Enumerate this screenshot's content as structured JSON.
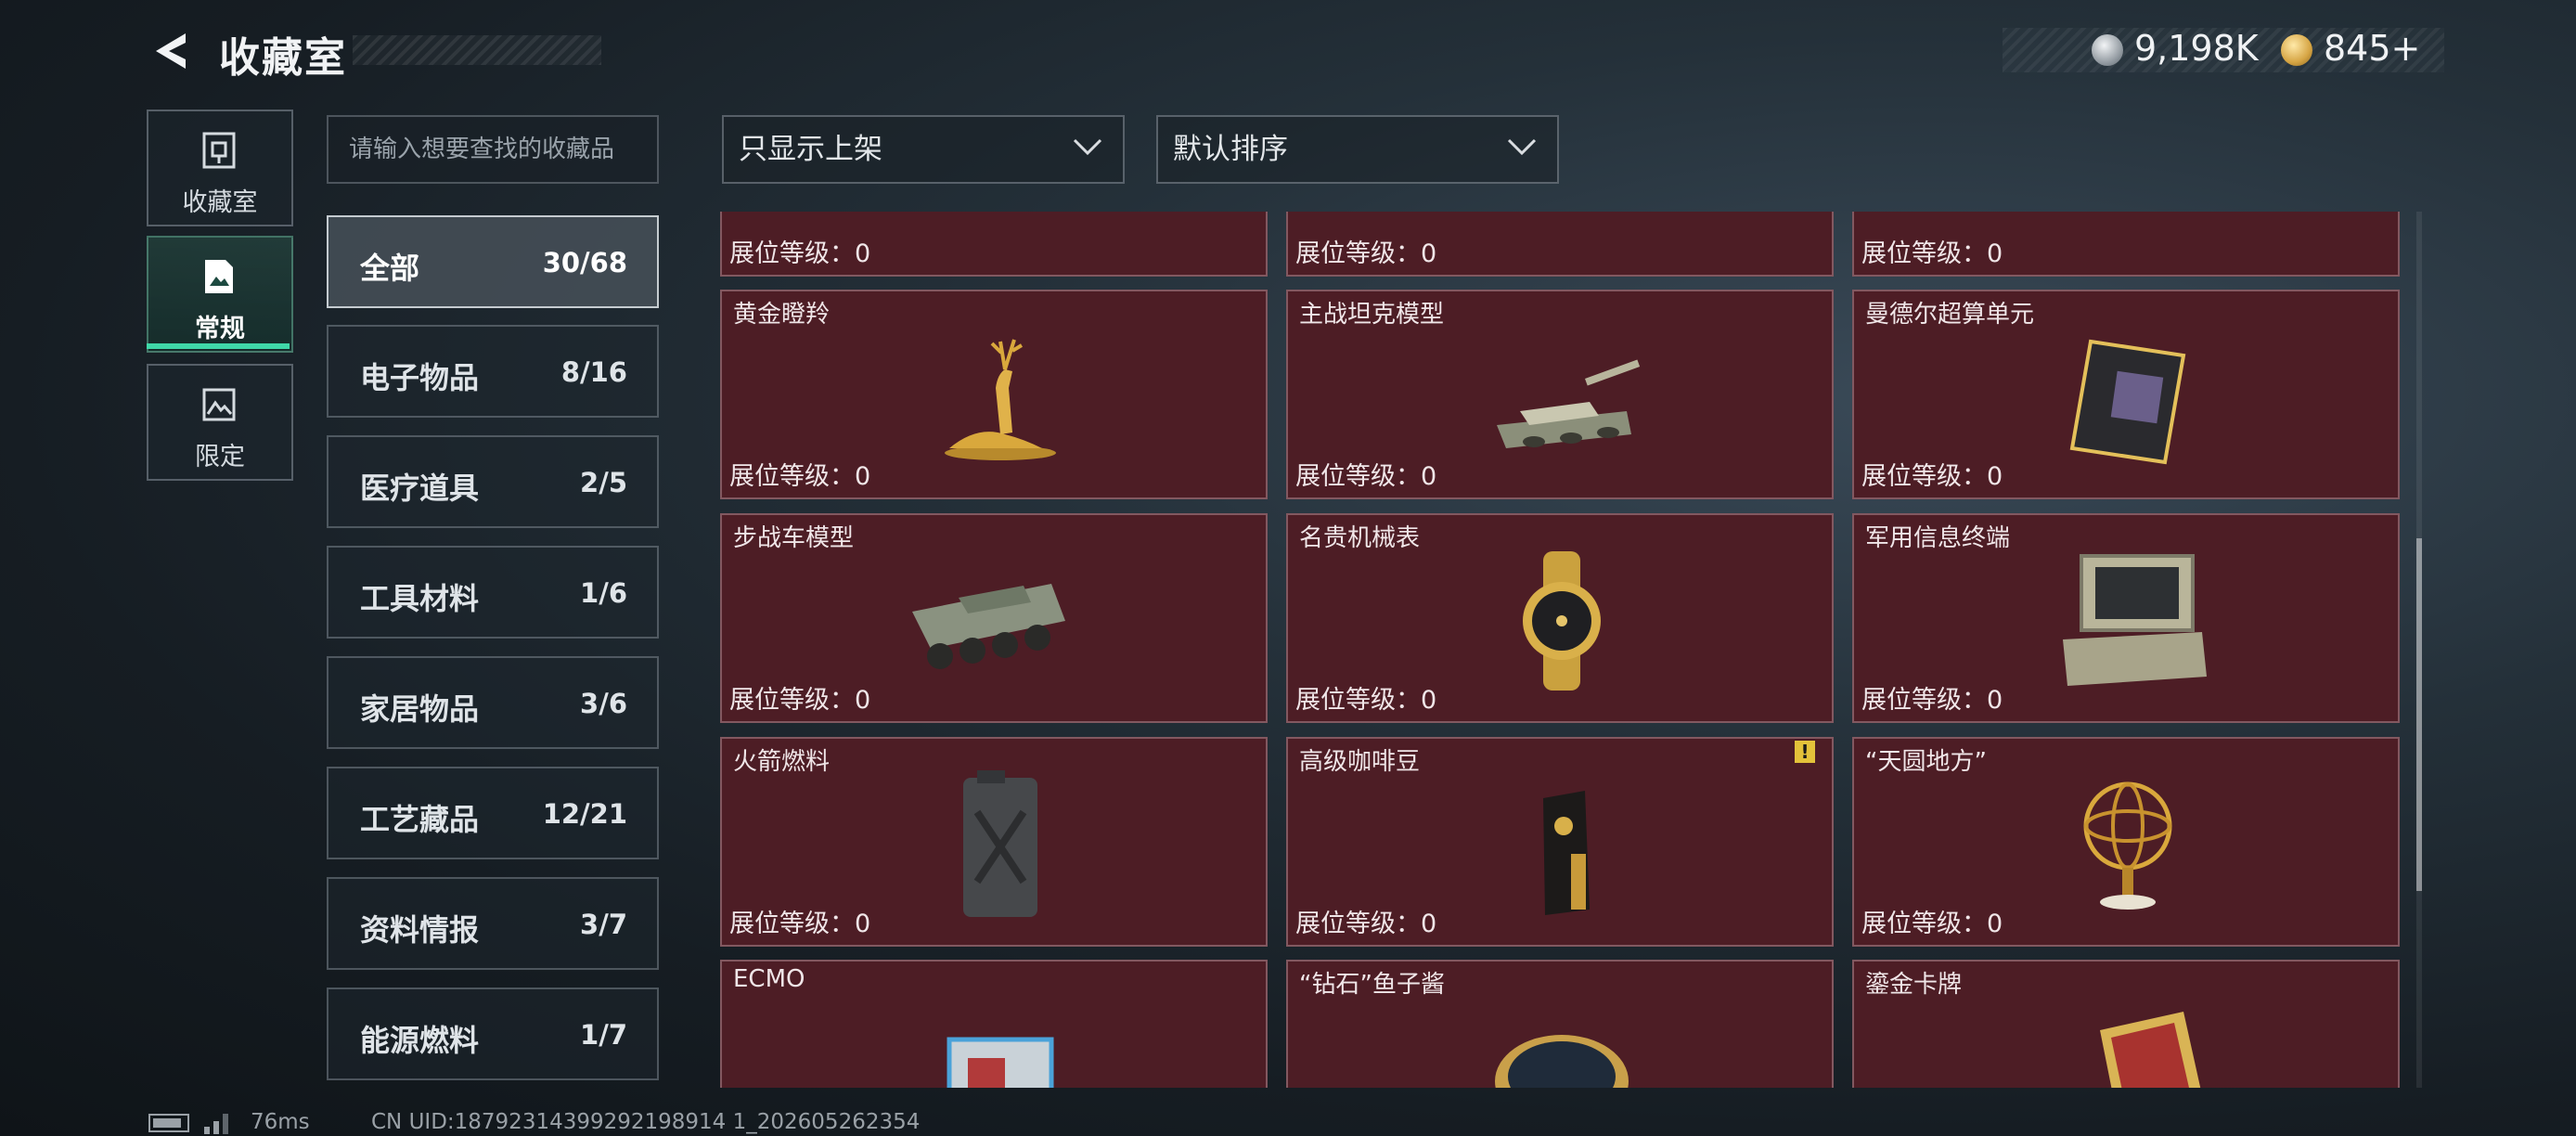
{
  "header": {
    "title": "收藏室",
    "currency_silver": "9,198K",
    "currency_gold": "845",
    "currency_gold_suffix": "+"
  },
  "side_tabs": [
    {
      "label": "收藏室",
      "icon": "vault-icon"
    },
    {
      "label": "常规",
      "icon": "document-icon",
      "active": true
    },
    {
      "label": "限定",
      "icon": "picture-icon"
    }
  ],
  "search": {
    "placeholder": "请输入想要查找的收藏品"
  },
  "filters": {
    "display": "只显示上架",
    "sort": "默认排序"
  },
  "categories": [
    {
      "name": "全部",
      "count": "30/68",
      "active": true
    },
    {
      "name": "电子物品",
      "count": "8/16"
    },
    {
      "name": "医疗道具",
      "count": "2/5"
    },
    {
      "name": "工具材料",
      "count": "1/6"
    },
    {
      "name": "家居物品",
      "count": "3/6"
    },
    {
      "name": "工艺藏品",
      "count": "12/21"
    },
    {
      "name": "资料情报",
      "count": "3/7"
    },
    {
      "name": "能源燃料",
      "count": "1/7"
    }
  ],
  "level_label": "展位等级：0",
  "items": [
    {
      "name": "",
      "icon": "partial-item-icon"
    },
    {
      "name": "",
      "icon": "partial-item-icon"
    },
    {
      "name": "",
      "icon": "partial-item-icon"
    },
    {
      "name": "黄金瞪羚",
      "icon": "golden-gazelle-icon"
    },
    {
      "name": "主战坦克模型",
      "icon": "tank-model-icon"
    },
    {
      "name": "曼德尔超算单元",
      "icon": "supercomputer-unit-icon"
    },
    {
      "name": "步战车模型",
      "icon": "ifv-model-icon"
    },
    {
      "name": "名贵机械表",
      "icon": "mechanical-watch-icon"
    },
    {
      "name": "军用信息终端",
      "icon": "military-terminal-icon"
    },
    {
      "name": "火箭燃料",
      "icon": "rocket-fuel-icon"
    },
    {
      "name": "高级咖啡豆",
      "icon": "coffee-beans-icon",
      "badge": "!"
    },
    {
      "name": "“天圆地方”",
      "icon": "armillary-sphere-icon"
    },
    {
      "name": "ECMO",
      "icon": "ecmo-icon"
    },
    {
      "name": "“钻石”鱼子酱",
      "icon": "caviar-tin-icon"
    },
    {
      "name": "鎏金卡牌",
      "icon": "gilded-card-icon"
    }
  ],
  "footer": {
    "ping": "76ms",
    "uid": "CN UID:18792314399292198914 1_202605262354"
  },
  "colors": {
    "accent": "#3fd8a8",
    "card_bg": "#4d1d25"
  }
}
